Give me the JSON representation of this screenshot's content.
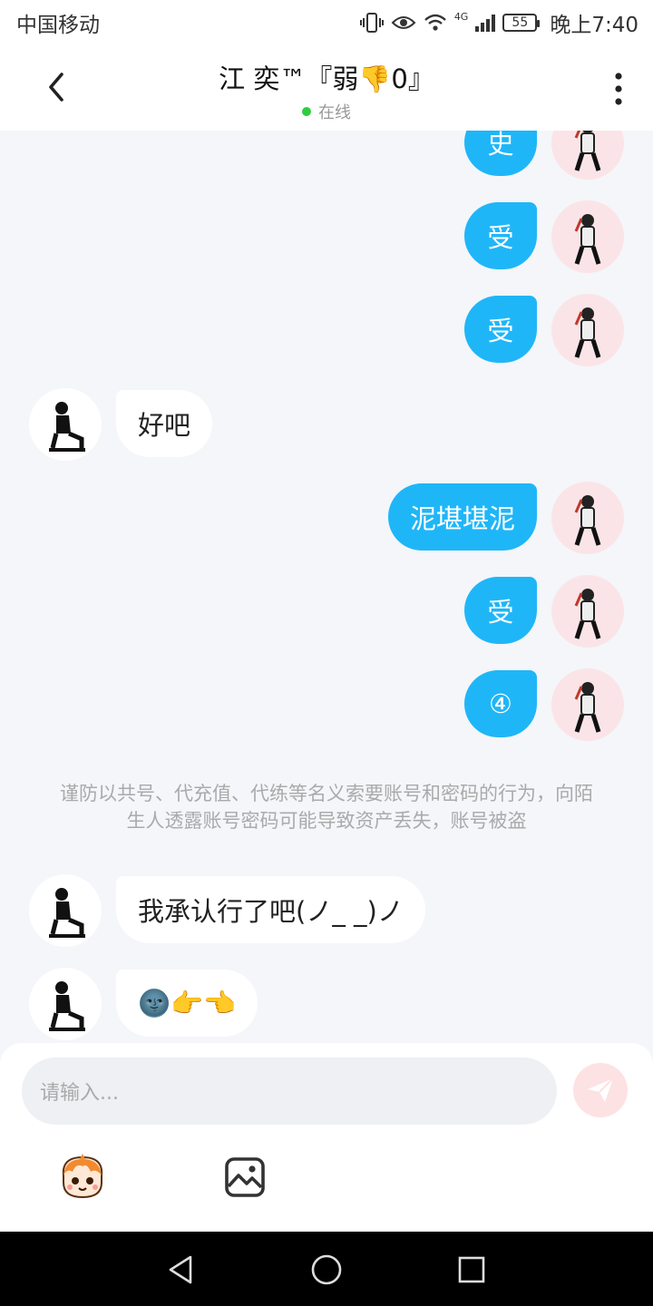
{
  "status_bar": {
    "carrier": "中国移动",
    "network": "4G",
    "battery": "55",
    "time": "晚上7:40"
  },
  "header": {
    "title": "江 奕™『弱👎0』",
    "status": "在线"
  },
  "messages": [
    {
      "side": "self",
      "text": "史"
    },
    {
      "side": "self",
      "text": "受"
    },
    {
      "side": "self",
      "text": "受"
    },
    {
      "side": "other",
      "text": "好吧"
    },
    {
      "side": "self",
      "text": "泥堪堪泥"
    },
    {
      "side": "self",
      "text": "受"
    },
    {
      "side": "self",
      "text": "④"
    },
    {
      "side": "other",
      "text": "我承认行了吧(ノ_ _)ノ"
    },
    {
      "side": "other",
      "text": "🌚👉👈"
    }
  ],
  "notice": "谨防以共号、代充值、代练等名义索要账号和密码的行为，向陌生人透露账号密码可能导致资产丢失，账号被盗",
  "input": {
    "placeholder": "请输入..."
  },
  "icons": {
    "back": "back-arrow-icon",
    "more": "more-vertical-icon",
    "send": "paper-plane-icon",
    "emoji": "emoji-face-icon",
    "image": "image-icon",
    "nav_back": "triangle-back-icon",
    "nav_home": "circle-home-icon",
    "nav_recent": "square-recent-icon"
  },
  "colors": {
    "self_bubble": "#1fb6f8",
    "other_bubble": "#ffffff",
    "background": "#f4f6f9",
    "online": "#2ecc40",
    "send_disabled": "#fde2e3"
  }
}
